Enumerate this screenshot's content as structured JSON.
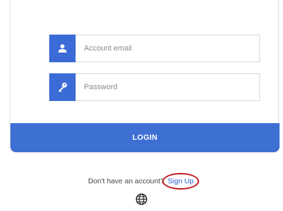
{
  "login_form": {
    "email_placeholder": "Account email",
    "password_placeholder": "Password",
    "login_label": "LOGIN"
  },
  "footer": {
    "prompt_text": "Don't have an account?",
    "signup_label": "Sign Up",
    "language_icon": "globe-icon"
  },
  "colors": {
    "accent": "#3e6fd3",
    "link": "#2a5bd0",
    "highlight_ring": "#c0181d"
  }
}
